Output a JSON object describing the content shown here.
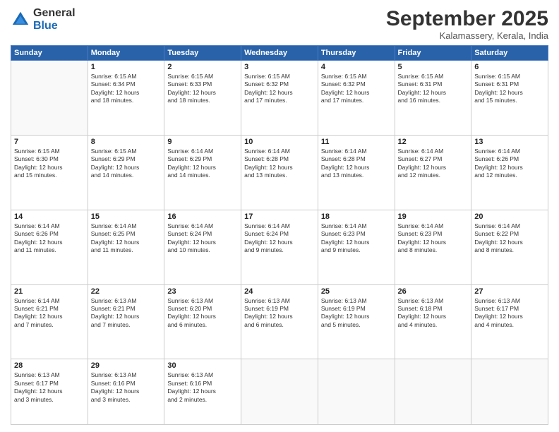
{
  "logo": {
    "general": "General",
    "blue": "Blue"
  },
  "header": {
    "month": "September 2025",
    "location": "Kalamassery, Kerala, India"
  },
  "weekdays": [
    "Sunday",
    "Monday",
    "Tuesday",
    "Wednesday",
    "Thursday",
    "Friday",
    "Saturday"
  ],
  "rows": [
    [
      {
        "day": "",
        "info": ""
      },
      {
        "day": "1",
        "info": "Sunrise: 6:15 AM\nSunset: 6:34 PM\nDaylight: 12 hours\nand 18 minutes."
      },
      {
        "day": "2",
        "info": "Sunrise: 6:15 AM\nSunset: 6:33 PM\nDaylight: 12 hours\nand 18 minutes."
      },
      {
        "day": "3",
        "info": "Sunrise: 6:15 AM\nSunset: 6:32 PM\nDaylight: 12 hours\nand 17 minutes."
      },
      {
        "day": "4",
        "info": "Sunrise: 6:15 AM\nSunset: 6:32 PM\nDaylight: 12 hours\nand 17 minutes."
      },
      {
        "day": "5",
        "info": "Sunrise: 6:15 AM\nSunset: 6:31 PM\nDaylight: 12 hours\nand 16 minutes."
      },
      {
        "day": "6",
        "info": "Sunrise: 6:15 AM\nSunset: 6:31 PM\nDaylight: 12 hours\nand 15 minutes."
      }
    ],
    [
      {
        "day": "7",
        "info": "Sunrise: 6:15 AM\nSunset: 6:30 PM\nDaylight: 12 hours\nand 15 minutes."
      },
      {
        "day": "8",
        "info": "Sunrise: 6:15 AM\nSunset: 6:29 PM\nDaylight: 12 hours\nand 14 minutes."
      },
      {
        "day": "9",
        "info": "Sunrise: 6:14 AM\nSunset: 6:29 PM\nDaylight: 12 hours\nand 14 minutes."
      },
      {
        "day": "10",
        "info": "Sunrise: 6:14 AM\nSunset: 6:28 PM\nDaylight: 12 hours\nand 13 minutes."
      },
      {
        "day": "11",
        "info": "Sunrise: 6:14 AM\nSunset: 6:28 PM\nDaylight: 12 hours\nand 13 minutes."
      },
      {
        "day": "12",
        "info": "Sunrise: 6:14 AM\nSunset: 6:27 PM\nDaylight: 12 hours\nand 12 minutes."
      },
      {
        "day": "13",
        "info": "Sunrise: 6:14 AM\nSunset: 6:26 PM\nDaylight: 12 hours\nand 12 minutes."
      }
    ],
    [
      {
        "day": "14",
        "info": "Sunrise: 6:14 AM\nSunset: 6:26 PM\nDaylight: 12 hours\nand 11 minutes."
      },
      {
        "day": "15",
        "info": "Sunrise: 6:14 AM\nSunset: 6:25 PM\nDaylight: 12 hours\nand 11 minutes."
      },
      {
        "day": "16",
        "info": "Sunrise: 6:14 AM\nSunset: 6:24 PM\nDaylight: 12 hours\nand 10 minutes."
      },
      {
        "day": "17",
        "info": "Sunrise: 6:14 AM\nSunset: 6:24 PM\nDaylight: 12 hours\nand 9 minutes."
      },
      {
        "day": "18",
        "info": "Sunrise: 6:14 AM\nSunset: 6:23 PM\nDaylight: 12 hours\nand 9 minutes."
      },
      {
        "day": "19",
        "info": "Sunrise: 6:14 AM\nSunset: 6:23 PM\nDaylight: 12 hours\nand 8 minutes."
      },
      {
        "day": "20",
        "info": "Sunrise: 6:14 AM\nSunset: 6:22 PM\nDaylight: 12 hours\nand 8 minutes."
      }
    ],
    [
      {
        "day": "21",
        "info": "Sunrise: 6:14 AM\nSunset: 6:21 PM\nDaylight: 12 hours\nand 7 minutes."
      },
      {
        "day": "22",
        "info": "Sunrise: 6:13 AM\nSunset: 6:21 PM\nDaylight: 12 hours\nand 7 minutes."
      },
      {
        "day": "23",
        "info": "Sunrise: 6:13 AM\nSunset: 6:20 PM\nDaylight: 12 hours\nand 6 minutes."
      },
      {
        "day": "24",
        "info": "Sunrise: 6:13 AM\nSunset: 6:19 PM\nDaylight: 12 hours\nand 6 minutes."
      },
      {
        "day": "25",
        "info": "Sunrise: 6:13 AM\nSunset: 6:19 PM\nDaylight: 12 hours\nand 5 minutes."
      },
      {
        "day": "26",
        "info": "Sunrise: 6:13 AM\nSunset: 6:18 PM\nDaylight: 12 hours\nand 4 minutes."
      },
      {
        "day": "27",
        "info": "Sunrise: 6:13 AM\nSunset: 6:17 PM\nDaylight: 12 hours\nand 4 minutes."
      }
    ],
    [
      {
        "day": "28",
        "info": "Sunrise: 6:13 AM\nSunset: 6:17 PM\nDaylight: 12 hours\nand 3 minutes."
      },
      {
        "day": "29",
        "info": "Sunrise: 6:13 AM\nSunset: 6:16 PM\nDaylight: 12 hours\nand 3 minutes."
      },
      {
        "day": "30",
        "info": "Sunrise: 6:13 AM\nSunset: 6:16 PM\nDaylight: 12 hours\nand 2 minutes."
      },
      {
        "day": "",
        "info": ""
      },
      {
        "day": "",
        "info": ""
      },
      {
        "day": "",
        "info": ""
      },
      {
        "day": "",
        "info": ""
      }
    ]
  ]
}
